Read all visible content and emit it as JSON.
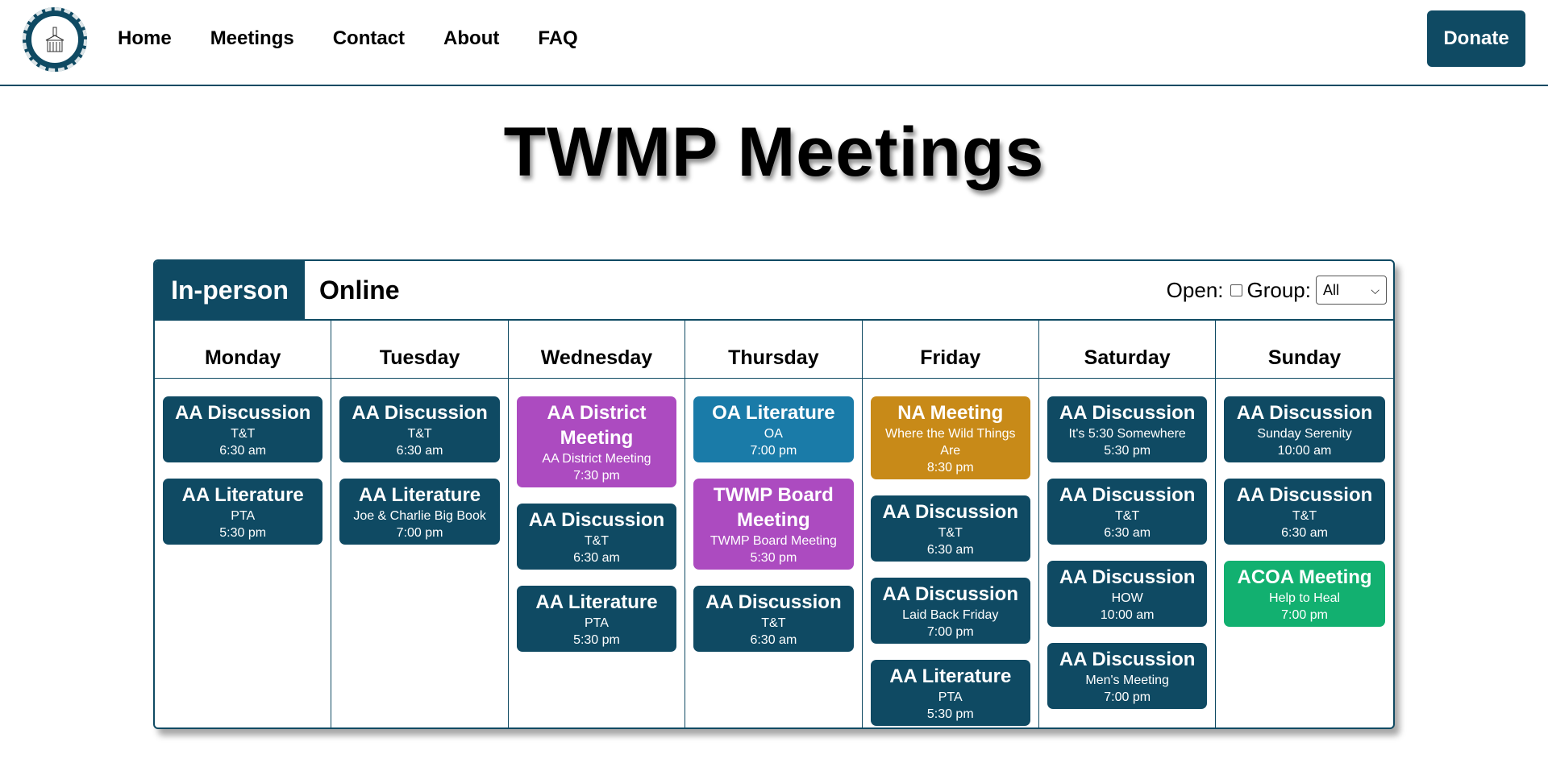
{
  "header": {
    "logo_text": "The Warrenton Meeting Place",
    "nav": [
      "Home",
      "Meetings",
      "Contact",
      "About",
      "FAQ"
    ],
    "donate_label": "Donate"
  },
  "page_title": "TWMP Meetings",
  "tabs": {
    "active": "In-person",
    "inactive": "Online"
  },
  "filters": {
    "open_label": "Open:",
    "group_label": "Group:",
    "group_value": "All"
  },
  "colors": {
    "primary": "#0f4a63",
    "district": "#ac4bc0",
    "oa": "#1a7ba8",
    "na": "#c88a18",
    "acoa": "#12b070"
  },
  "days": [
    {
      "name": "Monday",
      "meetings": [
        {
          "type": "aa",
          "title": "AA Discussion",
          "group": "T&T",
          "time": "6:30 am"
        },
        {
          "type": "aa",
          "title": "AA Literature",
          "group": "PTA",
          "time": "5:30 pm"
        }
      ]
    },
    {
      "name": "Tuesday",
      "meetings": [
        {
          "type": "aa",
          "title": "AA Discussion",
          "group": "T&T",
          "time": "6:30 am"
        },
        {
          "type": "aa",
          "title": "AA Literature",
          "group": "Joe & Charlie Big Book",
          "time": "7:00 pm"
        }
      ]
    },
    {
      "name": "Wednesday",
      "meetings": [
        {
          "type": "district",
          "title": "AA District Meeting",
          "group": "AA District Meeting",
          "time": "7:30 pm"
        },
        {
          "type": "aa",
          "title": "AA Discussion",
          "group": "T&T",
          "time": "6:30 am"
        },
        {
          "type": "aa",
          "title": "AA Literature",
          "group": "PTA",
          "time": "5:30 pm"
        }
      ]
    },
    {
      "name": "Thursday",
      "meetings": [
        {
          "type": "oa",
          "title": "OA Literature",
          "group": "OA",
          "time": "7:00 pm"
        },
        {
          "type": "district",
          "title": "TWMP Board Meeting",
          "group": "TWMP Board Meeting",
          "time": "5:30 pm"
        },
        {
          "type": "aa",
          "title": "AA Discussion",
          "group": "T&T",
          "time": "6:30 am"
        }
      ]
    },
    {
      "name": "Friday",
      "meetings": [
        {
          "type": "na",
          "title": "NA Meeting",
          "group": "Where the Wild Things Are",
          "time": "8:30 pm"
        },
        {
          "type": "aa",
          "title": "AA Discussion",
          "group": "T&T",
          "time": "6:30 am"
        },
        {
          "type": "aa",
          "title": "AA Discussion",
          "group": "Laid Back Friday",
          "time": "7:00 pm"
        },
        {
          "type": "aa",
          "title": "AA Literature",
          "group": "PTA",
          "time": "5:30 pm"
        }
      ]
    },
    {
      "name": "Saturday",
      "meetings": [
        {
          "type": "aa",
          "title": "AA Discussion",
          "group": "It's 5:30 Somewhere",
          "time": "5:30 pm"
        },
        {
          "type": "aa",
          "title": "AA Discussion",
          "group": "T&T",
          "time": "6:30 am"
        },
        {
          "type": "aa",
          "title": "AA Discussion",
          "group": "HOW",
          "time": "10:00 am"
        },
        {
          "type": "aa",
          "title": "AA Discussion",
          "group": "Men's Meeting",
          "time": "7:00 pm"
        }
      ]
    },
    {
      "name": "Sunday",
      "meetings": [
        {
          "type": "aa",
          "title": "AA Discussion",
          "group": "Sunday Serenity",
          "time": "10:00 am"
        },
        {
          "type": "aa",
          "title": "AA Discussion",
          "group": "T&T",
          "time": "6:30 am"
        },
        {
          "type": "acoa",
          "title": "ACOA Meeting",
          "group": "Help to Heal",
          "time": "7:00 pm"
        }
      ]
    }
  ]
}
